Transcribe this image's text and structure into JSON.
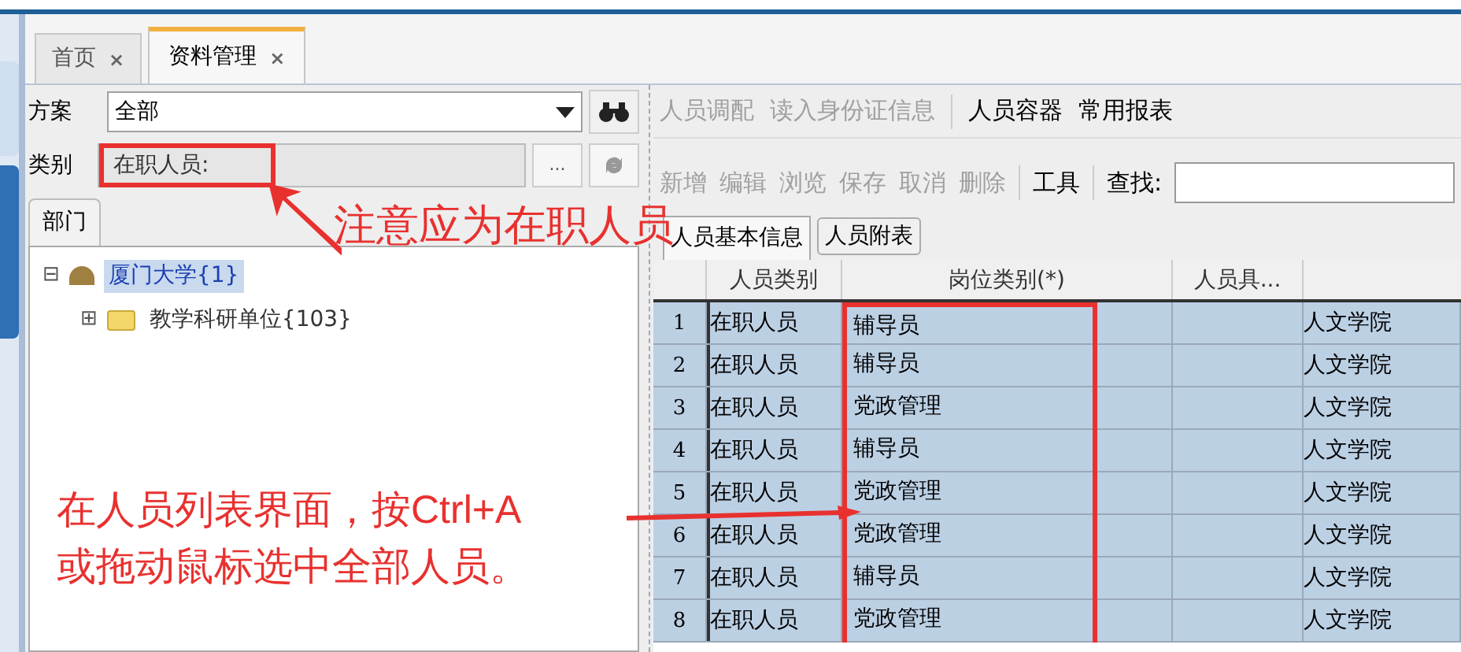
{
  "tabs": [
    {
      "label": "首页",
      "close": "×",
      "selected": false
    },
    {
      "label": "资料管理",
      "close": "×",
      "selected": true
    }
  ],
  "scheme": {
    "label": "方案",
    "value": "全部"
  },
  "category": {
    "label": "类别",
    "value": "在职人员:",
    "button": "..."
  },
  "dept_tab": {
    "label": "部门"
  },
  "tree": [
    {
      "label": "厦门大学{1}",
      "toggle": "⊟",
      "selected": true,
      "children": [
        {
          "label": "教学科研单位{103}",
          "toggle": "⊞",
          "selected": false
        }
      ]
    }
  ],
  "toolbar1": [
    {
      "label": "人员调配",
      "disabled": true
    },
    {
      "label": "读入身份证信息",
      "disabled": true
    },
    {
      "label": "人员容器",
      "disabled": false
    },
    {
      "label": "常用报表",
      "disabled": false
    }
  ],
  "toolbar2": [
    {
      "label": "新增",
      "disabled": true
    },
    {
      "label": "编辑",
      "disabled": true
    },
    {
      "label": "浏览",
      "disabled": true
    },
    {
      "label": "保存",
      "disabled": true
    },
    {
      "label": "取消",
      "disabled": true
    },
    {
      "label": "删除",
      "disabled": true
    },
    {
      "label": "工具",
      "disabled": false
    }
  ],
  "search": {
    "label": "查找:"
  },
  "sub_tabs": [
    {
      "label": "人员基本信息",
      "selected": true
    },
    {
      "label": "人员附表",
      "selected": false
    }
  ],
  "table": {
    "columns": [
      "人员类别",
      "岗位类别(*)",
      "人员具..."
    ],
    "rows": [
      {
        "index": "1",
        "cells": [
          "在职人员",
          "辅导员",
          "",
          "人文学院"
        ],
        "selected": true
      },
      {
        "index": "2",
        "cells": [
          "在职人员",
          "辅导员",
          "",
          "人文学院"
        ],
        "selected": true
      },
      {
        "index": "3",
        "cells": [
          "在职人员",
          "党政管理",
          "",
          "人文学院"
        ],
        "selected": true
      },
      {
        "index": "4",
        "cells": [
          "在职人员",
          "辅导员",
          "",
          "人文学院"
        ],
        "selected": true
      },
      {
        "index": "5",
        "cells": [
          "在职人员",
          "党政管理",
          "",
          "人文学院"
        ],
        "selected": true
      },
      {
        "index": "6",
        "cells": [
          "在职人员",
          "党政管理",
          "",
          "人文学院"
        ],
        "selected": true
      },
      {
        "index": "7",
        "cells": [
          "在职人员",
          "辅导员",
          "",
          "人文学院"
        ],
        "selected": true
      },
      {
        "index": "8",
        "cells": [
          "在职人员",
          "党政管理",
          "",
          "人文学院"
        ],
        "selected": true
      }
    ]
  },
  "annotations": [
    {
      "text": "注意应为在职人员"
    },
    {
      "text": "在人员列表界面，按Ctrl+A\n或拖动鼠标选中全部人员。"
    }
  ]
}
